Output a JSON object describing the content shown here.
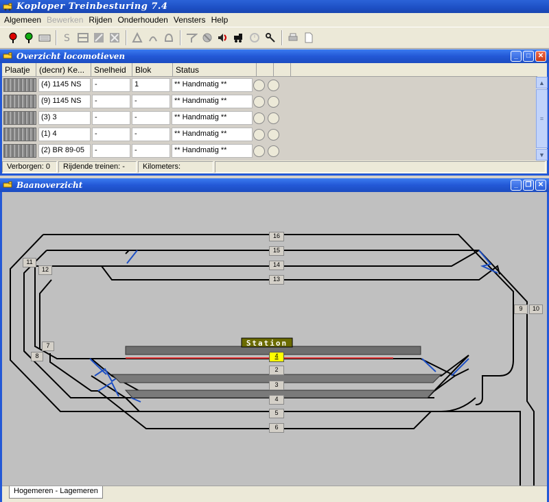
{
  "app": {
    "title": "Koploper Treinbesturing 7.4"
  },
  "menu": [
    "Algemeen",
    "Bewerken",
    "Rijden",
    "Onderhouden",
    "Vensters",
    "Help"
  ],
  "loco_panel": {
    "title": "Overzicht locomotieven",
    "columns": [
      "Plaatje",
      "(decnr) Ke...",
      "Snelheid",
      "Blok",
      "Status"
    ],
    "rows": [
      {
        "name": "(4) 1145 NS",
        "speed": "-",
        "block": "1",
        "status": "** Handmatig **"
      },
      {
        "name": "(9) 1145 NS",
        "speed": "-",
        "block": "-",
        "status": "** Handmatig **"
      },
      {
        "name": "(3) 3",
        "speed": "-",
        "block": "-",
        "status": "** Handmatig **"
      },
      {
        "name": "(1) 4",
        "speed": "-",
        "block": "-",
        "status": "** Handmatig **"
      },
      {
        "name": "(2) BR 89-05",
        "speed": "-",
        "block": "-",
        "status": "** Handmatig **"
      }
    ],
    "status": {
      "hidden": "Verborgen: 0",
      "trains": "Rijdende treinen: -",
      "km": "Kilometers:"
    }
  },
  "track_panel": {
    "title": "Baanoverzicht",
    "station_label": "Station",
    "blocks": [
      "16",
      "15",
      "14",
      "13",
      "11",
      "12",
      "9",
      "10",
      "7",
      "8",
      "4",
      "2",
      "3",
      "4",
      "5",
      "6"
    ],
    "tab": "Hogemeren - Lagemeren"
  },
  "colors": {
    "accent": "#2358d6",
    "occupied": "#ffff00",
    "station": "#6b6b00",
    "track": "#000000",
    "switch": "#1d4fc4"
  }
}
